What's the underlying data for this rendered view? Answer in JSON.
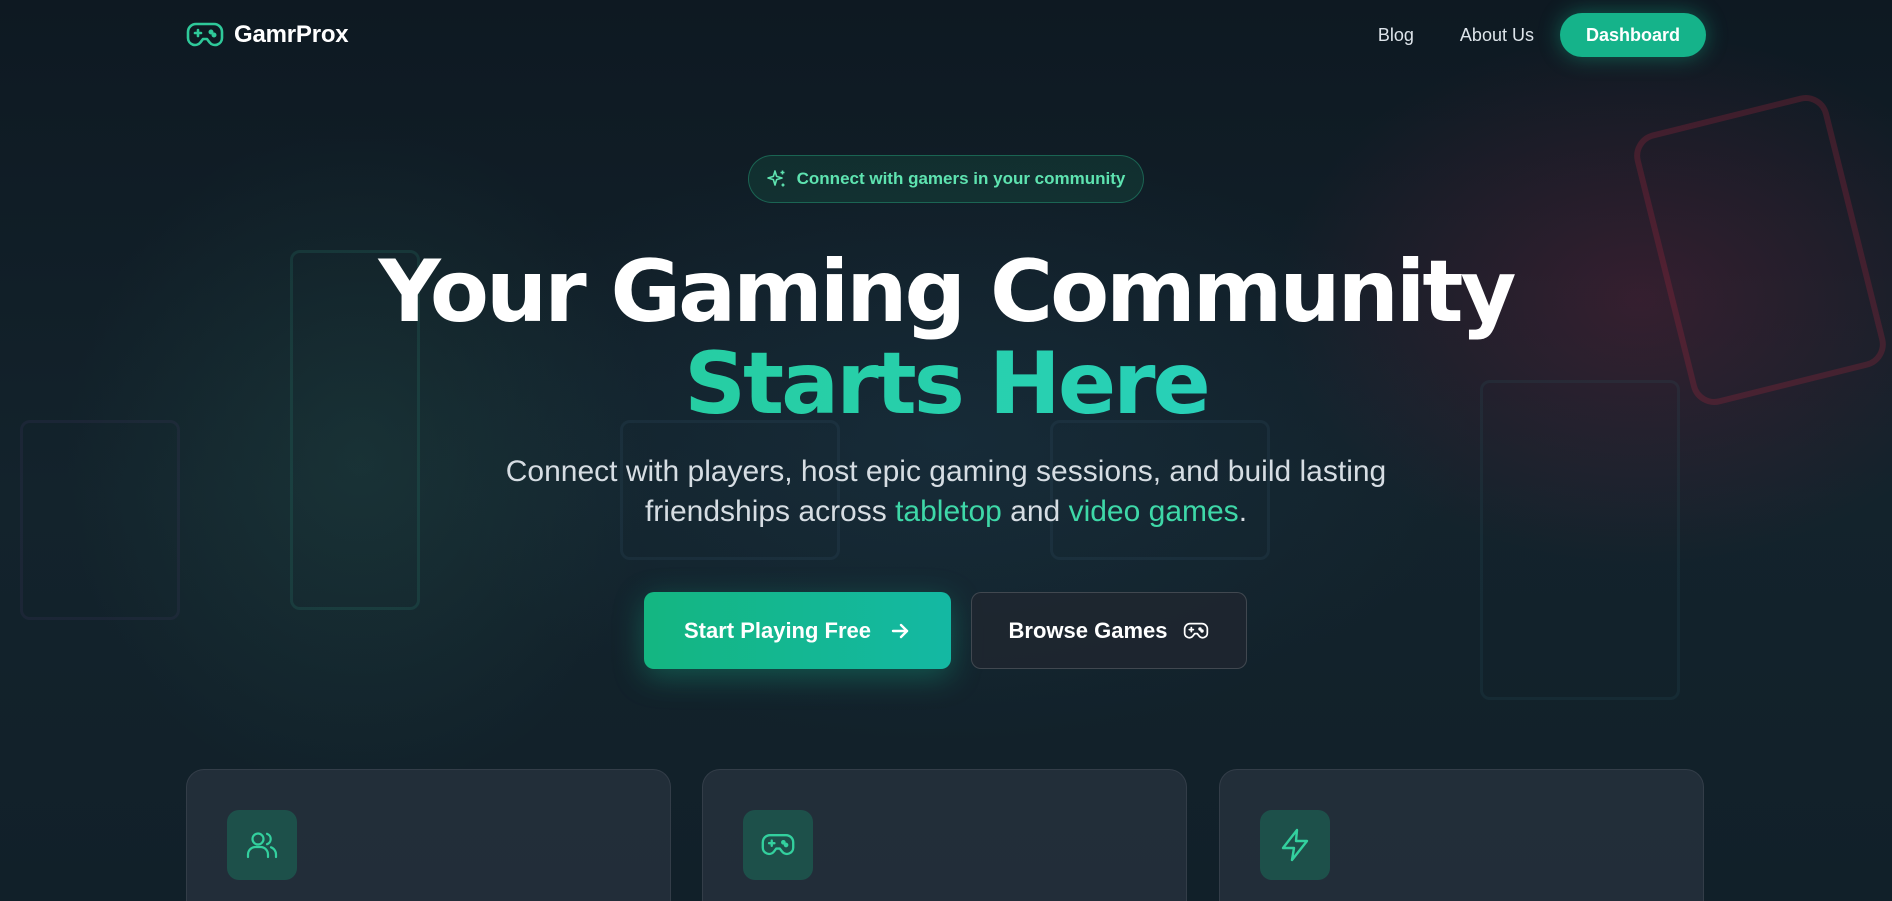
{
  "brand": {
    "name": "GamrProx",
    "icon": "gamepad-icon"
  },
  "nav": {
    "links": [
      "Blog",
      "About Us"
    ],
    "dashboard_label": "Dashboard"
  },
  "hero": {
    "badge": {
      "icon": "sparkles-icon",
      "text": "Connect with gamers in your community"
    },
    "title_line1": "Your Gaming Community",
    "title_line2": "Starts Here",
    "subtitle_part1": "Connect with players, host epic gaming sessions, and build lasting",
    "subtitle_part2": "friendships across ",
    "subtitle_hl1": "tabletop",
    "subtitle_and": " and ",
    "subtitle_hl2": "video games",
    "subtitle_end": ".",
    "primary_cta": {
      "label": "Start Playing Free",
      "icon": "arrow-right-icon"
    },
    "secondary_cta": {
      "label": "Browse Games",
      "icon": "gamepad-icon"
    }
  },
  "features": [
    {
      "icon": "users-icon"
    },
    {
      "icon": "gamepad-icon"
    },
    {
      "icon": "lightning-icon"
    }
  ],
  "colors": {
    "accent": "#15b38a",
    "accent_text": "#3ed8a8",
    "background": "#0f1a22"
  }
}
